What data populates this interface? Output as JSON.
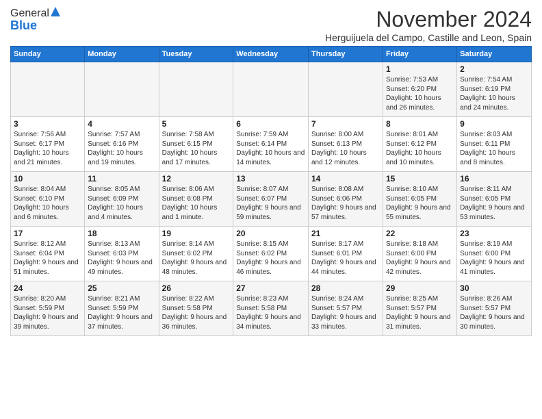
{
  "header": {
    "logo_general": "General",
    "logo_blue": "Blue",
    "month_title": "November 2024",
    "subtitle": "Herguijuela del Campo, Castille and Leon, Spain"
  },
  "weekdays": [
    "Sunday",
    "Monday",
    "Tuesday",
    "Wednesday",
    "Thursday",
    "Friday",
    "Saturday"
  ],
  "weeks": [
    [
      {
        "day": "",
        "info": ""
      },
      {
        "day": "",
        "info": ""
      },
      {
        "day": "",
        "info": ""
      },
      {
        "day": "",
        "info": ""
      },
      {
        "day": "",
        "info": ""
      },
      {
        "day": "1",
        "info": "Sunrise: 7:53 AM\nSunset: 6:20 PM\nDaylight: 10 hours and 26 minutes."
      },
      {
        "day": "2",
        "info": "Sunrise: 7:54 AM\nSunset: 6:19 PM\nDaylight: 10 hours and 24 minutes."
      }
    ],
    [
      {
        "day": "3",
        "info": "Sunrise: 7:56 AM\nSunset: 6:17 PM\nDaylight: 10 hours and 21 minutes."
      },
      {
        "day": "4",
        "info": "Sunrise: 7:57 AM\nSunset: 6:16 PM\nDaylight: 10 hours and 19 minutes."
      },
      {
        "day": "5",
        "info": "Sunrise: 7:58 AM\nSunset: 6:15 PM\nDaylight: 10 hours and 17 minutes."
      },
      {
        "day": "6",
        "info": "Sunrise: 7:59 AM\nSunset: 6:14 PM\nDaylight: 10 hours and 14 minutes."
      },
      {
        "day": "7",
        "info": "Sunrise: 8:00 AM\nSunset: 6:13 PM\nDaylight: 10 hours and 12 minutes."
      },
      {
        "day": "8",
        "info": "Sunrise: 8:01 AM\nSunset: 6:12 PM\nDaylight: 10 hours and 10 minutes."
      },
      {
        "day": "9",
        "info": "Sunrise: 8:03 AM\nSunset: 6:11 PM\nDaylight: 10 hours and 8 minutes."
      }
    ],
    [
      {
        "day": "10",
        "info": "Sunrise: 8:04 AM\nSunset: 6:10 PM\nDaylight: 10 hours and 6 minutes."
      },
      {
        "day": "11",
        "info": "Sunrise: 8:05 AM\nSunset: 6:09 PM\nDaylight: 10 hours and 4 minutes."
      },
      {
        "day": "12",
        "info": "Sunrise: 8:06 AM\nSunset: 6:08 PM\nDaylight: 10 hours and 1 minute."
      },
      {
        "day": "13",
        "info": "Sunrise: 8:07 AM\nSunset: 6:07 PM\nDaylight: 9 hours and 59 minutes."
      },
      {
        "day": "14",
        "info": "Sunrise: 8:08 AM\nSunset: 6:06 PM\nDaylight: 9 hours and 57 minutes."
      },
      {
        "day": "15",
        "info": "Sunrise: 8:10 AM\nSunset: 6:05 PM\nDaylight: 9 hours and 55 minutes."
      },
      {
        "day": "16",
        "info": "Sunrise: 8:11 AM\nSunset: 6:05 PM\nDaylight: 9 hours and 53 minutes."
      }
    ],
    [
      {
        "day": "17",
        "info": "Sunrise: 8:12 AM\nSunset: 6:04 PM\nDaylight: 9 hours and 51 minutes."
      },
      {
        "day": "18",
        "info": "Sunrise: 8:13 AM\nSunset: 6:03 PM\nDaylight: 9 hours and 49 minutes."
      },
      {
        "day": "19",
        "info": "Sunrise: 8:14 AM\nSunset: 6:02 PM\nDaylight: 9 hours and 48 minutes."
      },
      {
        "day": "20",
        "info": "Sunrise: 8:15 AM\nSunset: 6:02 PM\nDaylight: 9 hours and 46 minutes."
      },
      {
        "day": "21",
        "info": "Sunrise: 8:17 AM\nSunset: 6:01 PM\nDaylight: 9 hours and 44 minutes."
      },
      {
        "day": "22",
        "info": "Sunrise: 8:18 AM\nSunset: 6:00 PM\nDaylight: 9 hours and 42 minutes."
      },
      {
        "day": "23",
        "info": "Sunrise: 8:19 AM\nSunset: 6:00 PM\nDaylight: 9 hours and 41 minutes."
      }
    ],
    [
      {
        "day": "24",
        "info": "Sunrise: 8:20 AM\nSunset: 5:59 PM\nDaylight: 9 hours and 39 minutes."
      },
      {
        "day": "25",
        "info": "Sunrise: 8:21 AM\nSunset: 5:59 PM\nDaylight: 9 hours and 37 minutes."
      },
      {
        "day": "26",
        "info": "Sunrise: 8:22 AM\nSunset: 5:58 PM\nDaylight: 9 hours and 36 minutes."
      },
      {
        "day": "27",
        "info": "Sunrise: 8:23 AM\nSunset: 5:58 PM\nDaylight: 9 hours and 34 minutes."
      },
      {
        "day": "28",
        "info": "Sunrise: 8:24 AM\nSunset: 5:57 PM\nDaylight: 9 hours and 33 minutes."
      },
      {
        "day": "29",
        "info": "Sunrise: 8:25 AM\nSunset: 5:57 PM\nDaylight: 9 hours and 31 minutes."
      },
      {
        "day": "30",
        "info": "Sunrise: 8:26 AM\nSunset: 5:57 PM\nDaylight: 9 hours and 30 minutes."
      }
    ]
  ]
}
